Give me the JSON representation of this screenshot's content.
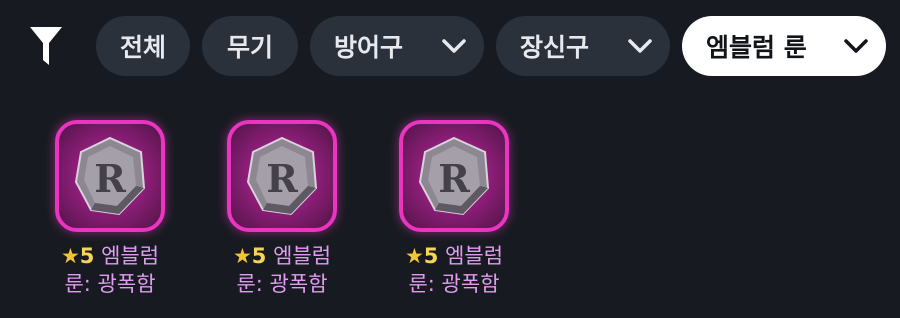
{
  "filters": {
    "all_label": "전체",
    "weapon_label": "무기",
    "armor_label": "방어구",
    "accessory_label": "장신구",
    "emblem_rune_label": "엠블럼 룬"
  },
  "items": [
    {
      "star": "★",
      "grade": "5",
      "name_line1": "엠블럼",
      "name_line2": "룬: 광폭함",
      "rune_glyph": "R"
    },
    {
      "star": "★",
      "grade": "5",
      "name_line1": "엠블럼",
      "name_line2": "룬: 광폭함",
      "rune_glyph": "R"
    },
    {
      "star": "★",
      "grade": "5",
      "name_line1": "엠블럼",
      "name_line2": "룬: 광폭함",
      "rune_glyph": "R"
    }
  ],
  "colors": {
    "background": "#171b21",
    "chip": "#2b313b",
    "chip_active": "#ffffff",
    "rune_border": "#e935c0",
    "item_name": "#e19bf0",
    "star": "#f4c531"
  },
  "icons": [
    "filter-icon",
    "chevron-down-icon",
    "rune-stone-icon"
  ]
}
